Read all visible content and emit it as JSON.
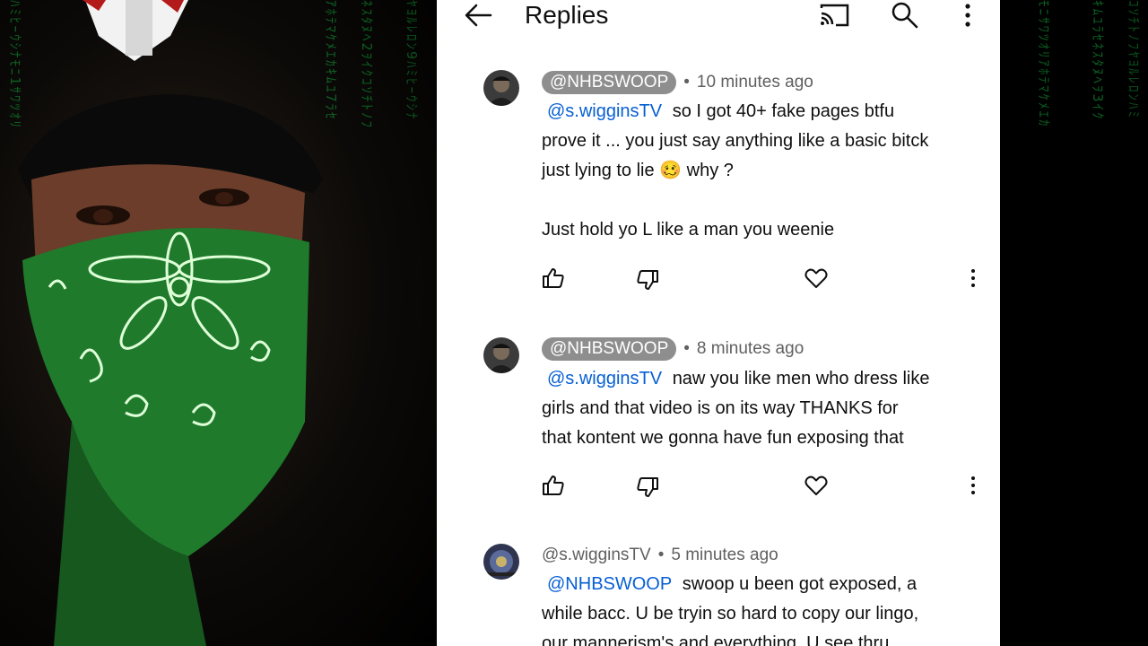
{
  "header": {
    "title": "Replies"
  },
  "comments": [
    {
      "handle": "@NHBSWOOP",
      "time": "10 minutes ago",
      "mention": "@s.wigginsTV",
      "lines": [
        "so I got 40+ fake pages btfu",
        "prove it ... you just say anything like a basic bitck",
        "just lying to lie 🥴 why ?",
        "",
        "Just hold yo L like a man you weenie"
      ]
    },
    {
      "handle": "@NHBSWOOP",
      "time": "8 minutes ago",
      "mention": "@s.wigginsTV",
      "lines": [
        "naw you like men who dress like",
        "girls and that video is on its way THANKS for",
        "that kontent we gonna have fun exposing that"
      ]
    },
    {
      "handle": "@s.wigginsTV",
      "time": "5 minutes ago",
      "mention": "@NHBSWOOP",
      "lines": [
        "swoop u been got exposed, a",
        "while bacc. U be tryin so hard to copy our lingo,",
        "our mannerism's and everything. U see thru"
      ]
    }
  ],
  "matrix": {
    "left": [
      "ﾊﾐﾋｰｳｼﾅﾓﾆ1ｻﾜﾂｵﾘ",
      "ｱﾎﾃﾏｹﾒｴｶｷﾑﾕ7ﾗｾ",
      "ﾈｽﾀﾇﾍ2ｦｲｸｺｿﾁﾄﾉﾌ",
      "ﾔﾖﾙﾚﾛﾝ9ﾊﾐﾋｰｳｼﾅ"
    ],
    "right": [
      "ﾓﾆｻﾜﾂｵﾘｱﾎﾃﾏｹﾒｴｶ",
      "ｷﾑﾕﾗｾﾈｽﾀﾇﾍｦ3ｲｸ",
      "ｺｿﾁﾄﾉﾌﾔﾖﾙﾚﾛﾝﾊﾐ"
    ]
  },
  "colors": {
    "accent": "#065fd4",
    "pill": "#8e8e8e",
    "bandana": "#1f7a2c",
    "matrix": "#0f7a2a"
  }
}
